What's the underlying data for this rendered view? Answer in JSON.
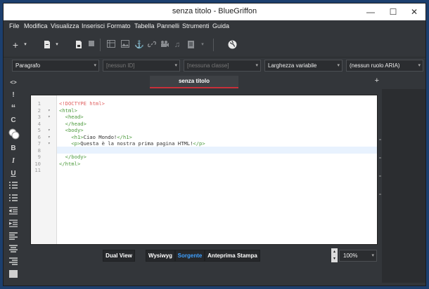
{
  "window": {
    "title": "senza titolo - BlueGriffon",
    "minimize": "—",
    "maximize": "☐",
    "close": "✕"
  },
  "menu": {
    "items": [
      "File",
      "Modifica",
      "Visualizza",
      "Inserisci",
      "Formato",
      "Tabella",
      "Pannelli",
      "Strumenti",
      "Guida"
    ]
  },
  "toolbar": {
    "icons": [
      "new-icon",
      "open-icon",
      "save-icon",
      "stop-icon",
      "table-icon",
      "image-icon",
      "anchor-icon",
      "link-icon",
      "video-icon",
      "audio-icon",
      "form-icon",
      "web-icon"
    ]
  },
  "format_bar": {
    "paragraph": "Paragrafo",
    "id_placeholder": "[nessun ID]",
    "class_placeholder": "[nessuna classe]",
    "width": "Larghezza variabile",
    "aria": "(nessun ruolo ARIA)"
  },
  "left_tools": {
    "icons": [
      "code-icon",
      "exclamation-icon",
      "quote-icon",
      "c-icon",
      "color-icon",
      "bold-icon",
      "italic-icon",
      "underline-icon",
      "bullet-list-icon",
      "number-list-icon",
      "outdent-icon",
      "indent-icon",
      "align-left-icon",
      "align-center-icon",
      "align-right-icon",
      "justify-icon"
    ]
  },
  "tabs": {
    "active": "senza titolo",
    "add": "+"
  },
  "editor": {
    "lines": [
      {
        "n": "1",
        "fold": "",
        "parts": [
          {
            "t": "<!DOCTYPE html>",
            "c": "doc"
          }
        ]
      },
      {
        "n": "2",
        "fold": "▾",
        "parts": [
          {
            "t": "<html>",
            "c": "tag"
          }
        ]
      },
      {
        "n": "3",
        "fold": "▾",
        "parts": [
          {
            "t": "  <head>",
            "c": "tag"
          }
        ]
      },
      {
        "n": "4",
        "fold": "",
        "parts": [
          {
            "t": "  </head>",
            "c": "tag"
          }
        ]
      },
      {
        "n": "5",
        "fold": "▾",
        "parts": [
          {
            "t": "  <body>",
            "c": "tag"
          }
        ]
      },
      {
        "n": "6",
        "fold": "▾",
        "parts": [
          {
            "t": "    <h1>",
            "c": "tag"
          },
          {
            "t": "Ciao Mondo!",
            "c": "txt"
          },
          {
            "t": "</h1>",
            "c": "tag"
          }
        ]
      },
      {
        "n": "7",
        "fold": "▾",
        "parts": [
          {
            "t": "    <p>",
            "c": "tag"
          },
          {
            "t": "Questa è la nostra prima pagina HTML!",
            "c": "txt"
          },
          {
            "t": "</p>",
            "c": "tag"
          }
        ]
      },
      {
        "n": "8",
        "fold": "",
        "parts": []
      },
      {
        "n": "9",
        "fold": "",
        "parts": [
          {
            "t": "  </body>",
            "c": "tag"
          }
        ]
      },
      {
        "n": "10",
        "fold": "",
        "parts": [
          {
            "t": "</html>",
            "c": "tag"
          }
        ]
      },
      {
        "n": "11",
        "fold": "",
        "parts": []
      }
    ],
    "current_line": 8
  },
  "bottom_bar": {
    "dual_view": "Dual View",
    "wysiwyg": "Wysiwyg",
    "source": "Sorgente",
    "print_preview": "Anteprima Stampa",
    "zoom": "100%"
  },
  "colors": {
    "accent": "#3fa0ff",
    "tab_underline": "#c8303a",
    "doctype": "#e06060",
    "tag": "#4c9a3c"
  }
}
